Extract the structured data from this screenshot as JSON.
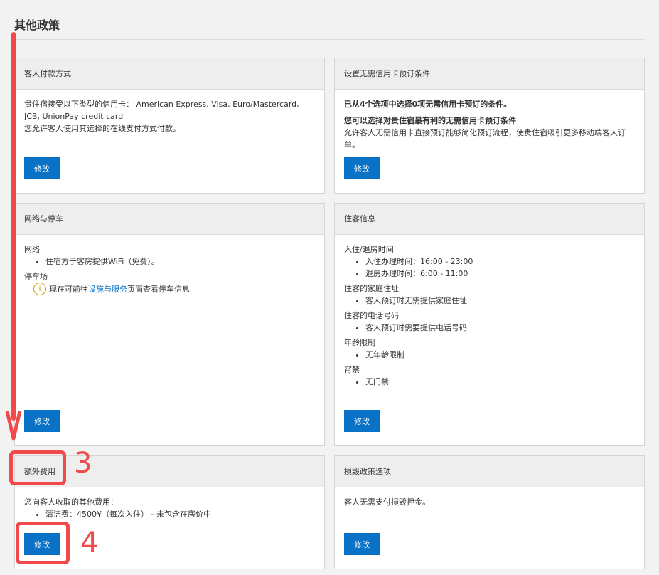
{
  "page": {
    "title": "其他政策"
  },
  "cards": {
    "payment": {
      "title": "客人付款方式",
      "line1": "贵住宿接受以下类型的信用卡： American Express, Visa, Euro/Mastercard, JCB, UnionPay credit card",
      "line2": "您允许客人使用其选择的在线支付方式付款。",
      "button": "修改"
    },
    "no_card": {
      "title": "设置无需信用卡预订条件",
      "summary": "已从4个选项中选择0项无需信用卡预订的条件。",
      "subtitle": "您可以选择对贵住宿最有利的无需信用卡预订条件",
      "desc": "允许客人无需信用卡直接预订能够简化预订流程，使贵住宿吸引更多移动端客人订单。",
      "button": "修改"
    },
    "internet": {
      "title": "网络与停车",
      "net_label": "网络",
      "net_item": "住宿方于客房提供WiFi（免费）。",
      "parking_label": "停车场",
      "parking_pre": "现在可前往",
      "parking_link": "设施与服务",
      "parking_post": "页面查看停车信息",
      "button": "修改"
    },
    "guest_info": {
      "title": "住客信息",
      "checkin_label": "入住/退房时间",
      "checkin_items": [
        "入住办理时间：16:00 - 23:00",
        "退房办理时间：6:00 - 11:00"
      ],
      "address_label": "住客的家庭住址",
      "address_item": "客人预订时无需提供家庭住址",
      "phone_label": "住客的电话号码",
      "phone_item": "客人预订时需要提供电话号码",
      "age_label": "年龄限制",
      "age_item": "无年龄限制",
      "curfew_label": "宵禁",
      "curfew_item": "无门禁",
      "button": "修改"
    },
    "extra_fees": {
      "title": "额外费用",
      "intro": "您向客人收取的其他费用：",
      "item": "清洁费：4500¥（每次入住） - 未包含在房价中",
      "button": "修改"
    },
    "damage": {
      "title": "损毁政策选项",
      "text": "客人无需支付损毁押金。",
      "button": "修改"
    }
  },
  "annotations": {
    "num3": "3",
    "num4": "4",
    "color": "#f04a4a"
  },
  "colors": {
    "accent": "#0a72c6",
    "header_bg": "#eeeeee",
    "page_bg": "#f2f2f2"
  }
}
